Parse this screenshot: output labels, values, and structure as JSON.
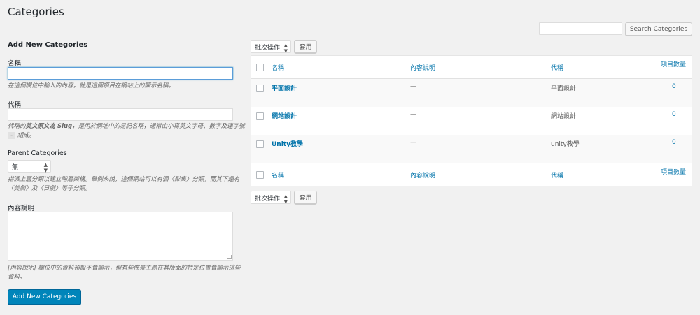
{
  "page": {
    "title": "Categories"
  },
  "search": {
    "placeholder": "",
    "button_label": "Search Categories"
  },
  "form": {
    "title": "Add New Categories",
    "name_label": "名稱",
    "name_desc": "在這個欄位中輸入的內容，就是這個項目在網站上的顯示名稱。",
    "slug_label": "代稱",
    "slug_desc_pre": "代稱的",
    "slug_desc_bold": "英文原文為 Slug",
    "slug_desc_mid": "，是用於網址中的易記名稱，通常由小寫英文字母、數字及連字號",
    "slug_desc_chip": "-",
    "slug_desc_post": "組成。",
    "parent_label": "Parent Categories",
    "parent_value": "無",
    "parent_desc": "指派上層分類以建立階層架構。舉例來說，這個網站可以有個〈影集〉分類，而其下還有〈美劇〉及〈日劇〉等子分類。",
    "description_label": "內容說明",
    "description_desc": "[內容說明] 欄位中的資料預設不會顯示，但有些佈景主題在其版面的特定位置會顯示這些資料。",
    "submit_label": "Add New Categories"
  },
  "bulk": {
    "select_label": "批次操作",
    "apply_label": "套用"
  },
  "table": {
    "headers": {
      "name": "名稱",
      "description": "內容說明",
      "slug": "代稱",
      "count": "項目數量"
    },
    "rows": [
      {
        "name": "平面設計",
        "description": "—",
        "slug": "平面設計",
        "count": "0"
      },
      {
        "name": "網站設計",
        "description": "—",
        "slug": "網站設計",
        "count": "0"
      },
      {
        "name": "Unity教學",
        "description": "—",
        "slug": "unity教學",
        "count": "0"
      }
    ]
  },
  "colors": {
    "link": "#0073aa",
    "primary": "#0085ba",
    "background": "#f1f1f1"
  }
}
